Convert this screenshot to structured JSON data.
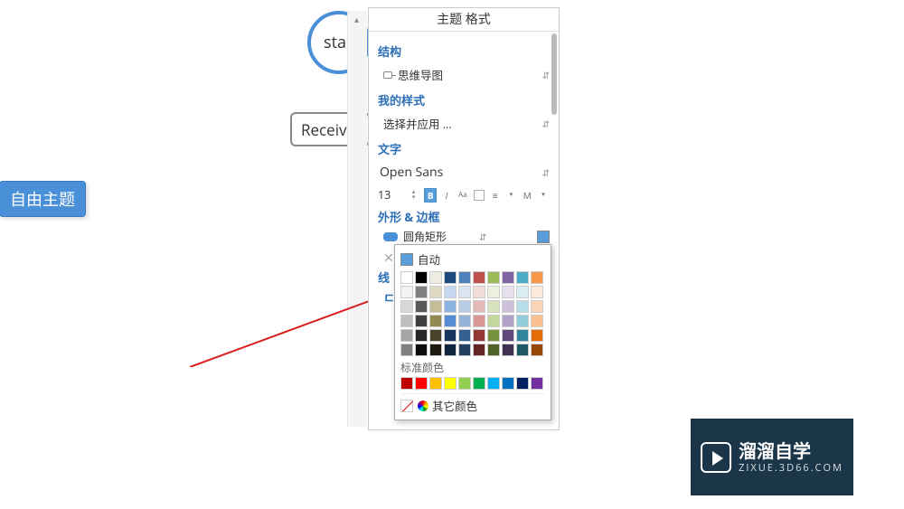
{
  "canvas": {
    "start_label": "sta",
    "receive_label": "Receiv"
  },
  "free_topic_label": "自由主题",
  "panel": {
    "title": "主题 格式",
    "section_structure": "结构",
    "structure_value": "思维导图",
    "section_mystyle": "我的样式",
    "mystyle_value": "选择并应用 ...",
    "section_text": "文字",
    "font_name": "Open Sans",
    "font_size": "13",
    "section_shape": "外形 & 边框",
    "shape_value": "圆角矩形",
    "section_line_partial": "线",
    "partial_char": "ㄷ"
  },
  "color_popup": {
    "auto_label": "自动",
    "theme_colors": [
      [
        "#ffffff",
        "#000000",
        "#eeece1",
        "#1f497d",
        "#4f81bd",
        "#c0504d",
        "#9bbb59",
        "#8064a2",
        "#4bacc6",
        "#f79646"
      ],
      [
        "#f2f2f2",
        "#7f7f7f",
        "#ddd9c3",
        "#c6d9f0",
        "#dbe5f1",
        "#f2dcdb",
        "#ebf1dd",
        "#e5e0ec",
        "#dbeef3",
        "#fdeada"
      ],
      [
        "#d8d8d8",
        "#595959",
        "#c4bd97",
        "#8db3e2",
        "#b8cce4",
        "#e5b9b7",
        "#d7e3bc",
        "#ccc1d9",
        "#b7dde8",
        "#fbd5b5"
      ],
      [
        "#bfbfbf",
        "#3f3f3f",
        "#938953",
        "#548dd4",
        "#95b3d7",
        "#d99694",
        "#c3d69b",
        "#b2a2c7",
        "#92cddc",
        "#fac08f"
      ],
      [
        "#a5a5a5",
        "#262626",
        "#494429",
        "#17365d",
        "#366092",
        "#953734",
        "#76923c",
        "#5f497a",
        "#31859b",
        "#e36c09"
      ],
      [
        "#7f7f7f",
        "#0c0c0c",
        "#1d1b10",
        "#0f243e",
        "#244061",
        "#632423",
        "#4f6128",
        "#3f3151",
        "#205867",
        "#974806"
      ]
    ],
    "standard_label": "标准颜色",
    "standard_colors": [
      "#c00000",
      "#ff0000",
      "#ffc000",
      "#ffff00",
      "#92d050",
      "#00b050",
      "#00b0f0",
      "#0070c0",
      "#002060",
      "#7030a0"
    ],
    "other_label": "其它颜色"
  },
  "watermark": {
    "cn": "溜溜自学",
    "en": "ZIXUE.3D66.COM"
  }
}
